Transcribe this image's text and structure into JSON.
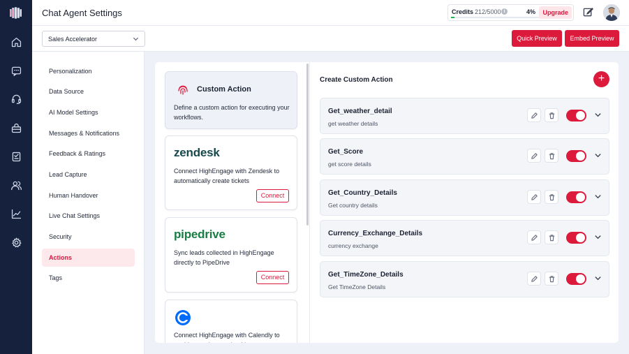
{
  "header": {
    "title": "Chat Agent Settings",
    "credits_label": "Credits",
    "credits_value": "212/5000",
    "credits_percent": "4%",
    "credits_used_fraction": 0.04,
    "upgrade_label": "Upgrade"
  },
  "toolbar": {
    "agent_selected": "Sales Accelerator",
    "quick_preview_label": "Quick Preview",
    "embed_preview_label": "Embed Preview"
  },
  "sidebar": {
    "icons": [
      "brand-logo-icon",
      "home-icon",
      "chat-icon",
      "headset-icon",
      "bag-icon",
      "document-check-icon",
      "users-icon",
      "chart-icon",
      "settings-icon"
    ]
  },
  "menu": {
    "items": [
      {
        "label": "Personalization"
      },
      {
        "label": "Data Source"
      },
      {
        "label": "AI Model Settings"
      },
      {
        "label": "Messages & Notifications"
      },
      {
        "label": "Feedback & Ratings"
      },
      {
        "label": "Lead Capture"
      },
      {
        "label": "Human Handover"
      },
      {
        "label": "Live Chat Settings"
      },
      {
        "label": "Security"
      },
      {
        "label": "Actions"
      },
      {
        "label": "Tags"
      }
    ],
    "active": "Actions"
  },
  "integrations": {
    "custom": {
      "title": "Custom Action",
      "description": "Define a custom action for executing your workflows."
    },
    "zendesk": {
      "brand": "zendesk",
      "description": "Connect HighEngage with Zendesk to automatically create tickets",
      "button": "Connect"
    },
    "pipedrive": {
      "brand": "pipedrive",
      "description": "Sync leads collected in HighEngage directly to PipeDrive",
      "button": "Connect"
    },
    "calendly": {
      "description": "Connect HighEngage with Calendly to enable appointment booking"
    }
  },
  "actions_panel": {
    "heading": "Create Custom Action",
    "add_label": "+",
    "actions": [
      {
        "name": "Get_weather_detail",
        "description": "get weather details",
        "enabled": true
      },
      {
        "name": "Get_Score",
        "description": "get score details",
        "enabled": true
      },
      {
        "name": "Get_Country_Details",
        "description": "Get country details",
        "enabled": true
      },
      {
        "name": "Currency_Exchange_Details",
        "description": "currency exchange",
        "enabled": true
      },
      {
        "name": "Get_TimeZone_Details",
        "description": "Get TimeZone Details",
        "enabled": true
      }
    ]
  },
  "colors": {
    "accent": "#dc1a3c",
    "rail": "#16213d",
    "progress": "#21b05a",
    "active_menu_bg": "#fde8ec"
  }
}
